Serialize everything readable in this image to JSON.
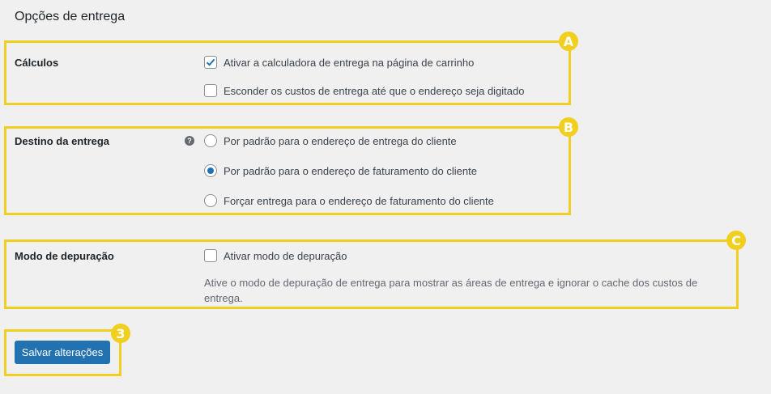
{
  "page_title": "Opções de entrega",
  "accent_color": "#f0cf1f",
  "primary_color": "#2271b1",
  "sections": {
    "calculos": {
      "badge": "A",
      "label": "Cálculos",
      "options": [
        {
          "label": "Ativar a calculadora de entrega na página de carrinho",
          "checked": true
        },
        {
          "label": "Esconder os custos de entrega até que o endereço seja digitado",
          "checked": false
        }
      ]
    },
    "destino": {
      "badge": "B",
      "label": "Destino da entrega",
      "help_icon": "question-icon",
      "options": [
        {
          "label": "Por padrão para o endereço de entrega do cliente",
          "selected": false
        },
        {
          "label": "Por padrão para o endereço de faturamento do cliente",
          "selected": true
        },
        {
          "label": "Forçar entrega para o endereço de faturamento do cliente",
          "selected": false
        }
      ]
    },
    "depuracao": {
      "badge": "C",
      "label": "Modo de depuração",
      "option": {
        "label": "Ativar modo de depuração",
        "checked": false
      },
      "description": "Ative o modo de depuração de entrega para mostrar as áreas de entrega e ignorar o cache dos custos de entrega."
    }
  },
  "save": {
    "badge": "3",
    "label": "Salvar alterações"
  }
}
